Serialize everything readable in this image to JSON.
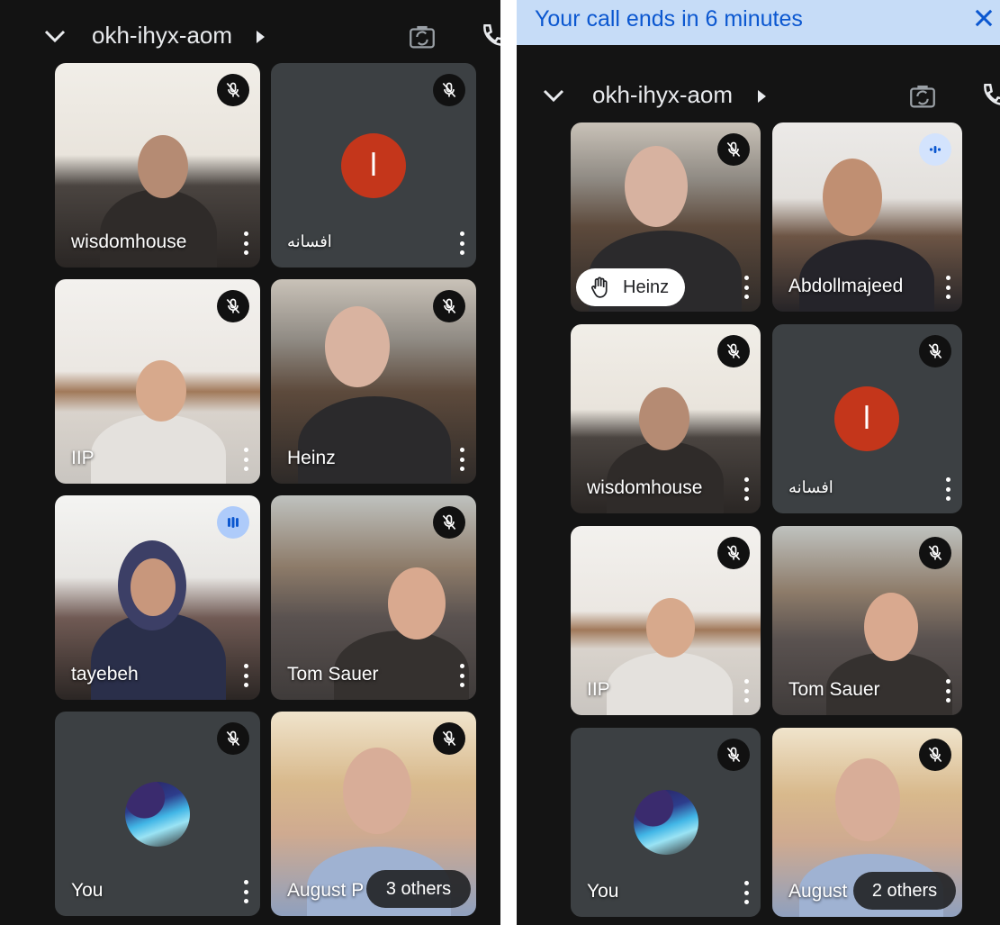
{
  "left": {
    "header": {
      "meeting_name": "okh-ihyx-aom",
      "icons": [
        "chevron-down-icon",
        "play-arrow-icon",
        "flip-camera-icon",
        "phone-icon"
      ]
    },
    "tiles": [
      {
        "name": "wisdomhouse",
        "mic": "muted"
      },
      {
        "name": "افسانه",
        "mic": "muted",
        "initial": "ا"
      },
      {
        "name": "IIP",
        "mic": "muted"
      },
      {
        "name": "Heinz",
        "mic": "muted"
      },
      {
        "name": "tayebeh",
        "mic": "speaking"
      },
      {
        "name": "Tom Sauer",
        "mic": "muted"
      },
      {
        "name": "You",
        "mic": "muted"
      },
      {
        "name": "August P",
        "mic": "muted",
        "others": "3 others"
      }
    ]
  },
  "right": {
    "banner": {
      "text": "Your call ends in 6 minutes",
      "background": "#c6dcf7",
      "text_color": "#0b57d0"
    },
    "header": {
      "meeting_name": "okh-ihyx-aom"
    },
    "tiles": [
      {
        "name": "Heinz",
        "mic": "muted",
        "hand_raised": true
      },
      {
        "name": "Abdollmajeed",
        "mic": "speaking"
      },
      {
        "name": "wisdomhouse",
        "mic": "muted"
      },
      {
        "name": "افسانه",
        "mic": "muted",
        "initial": "ا"
      },
      {
        "name": "IIP",
        "mic": "muted"
      },
      {
        "name": "Tom Sauer",
        "mic": "muted"
      },
      {
        "name": "You",
        "mic": "muted"
      },
      {
        "name": "August",
        "mic": "muted",
        "others": "2 others"
      }
    ]
  },
  "colors": {
    "background": "#131313",
    "tile": "#3c4043",
    "avatar_initial": "#c4361b",
    "speaking_badge": "#aecbfa"
  }
}
